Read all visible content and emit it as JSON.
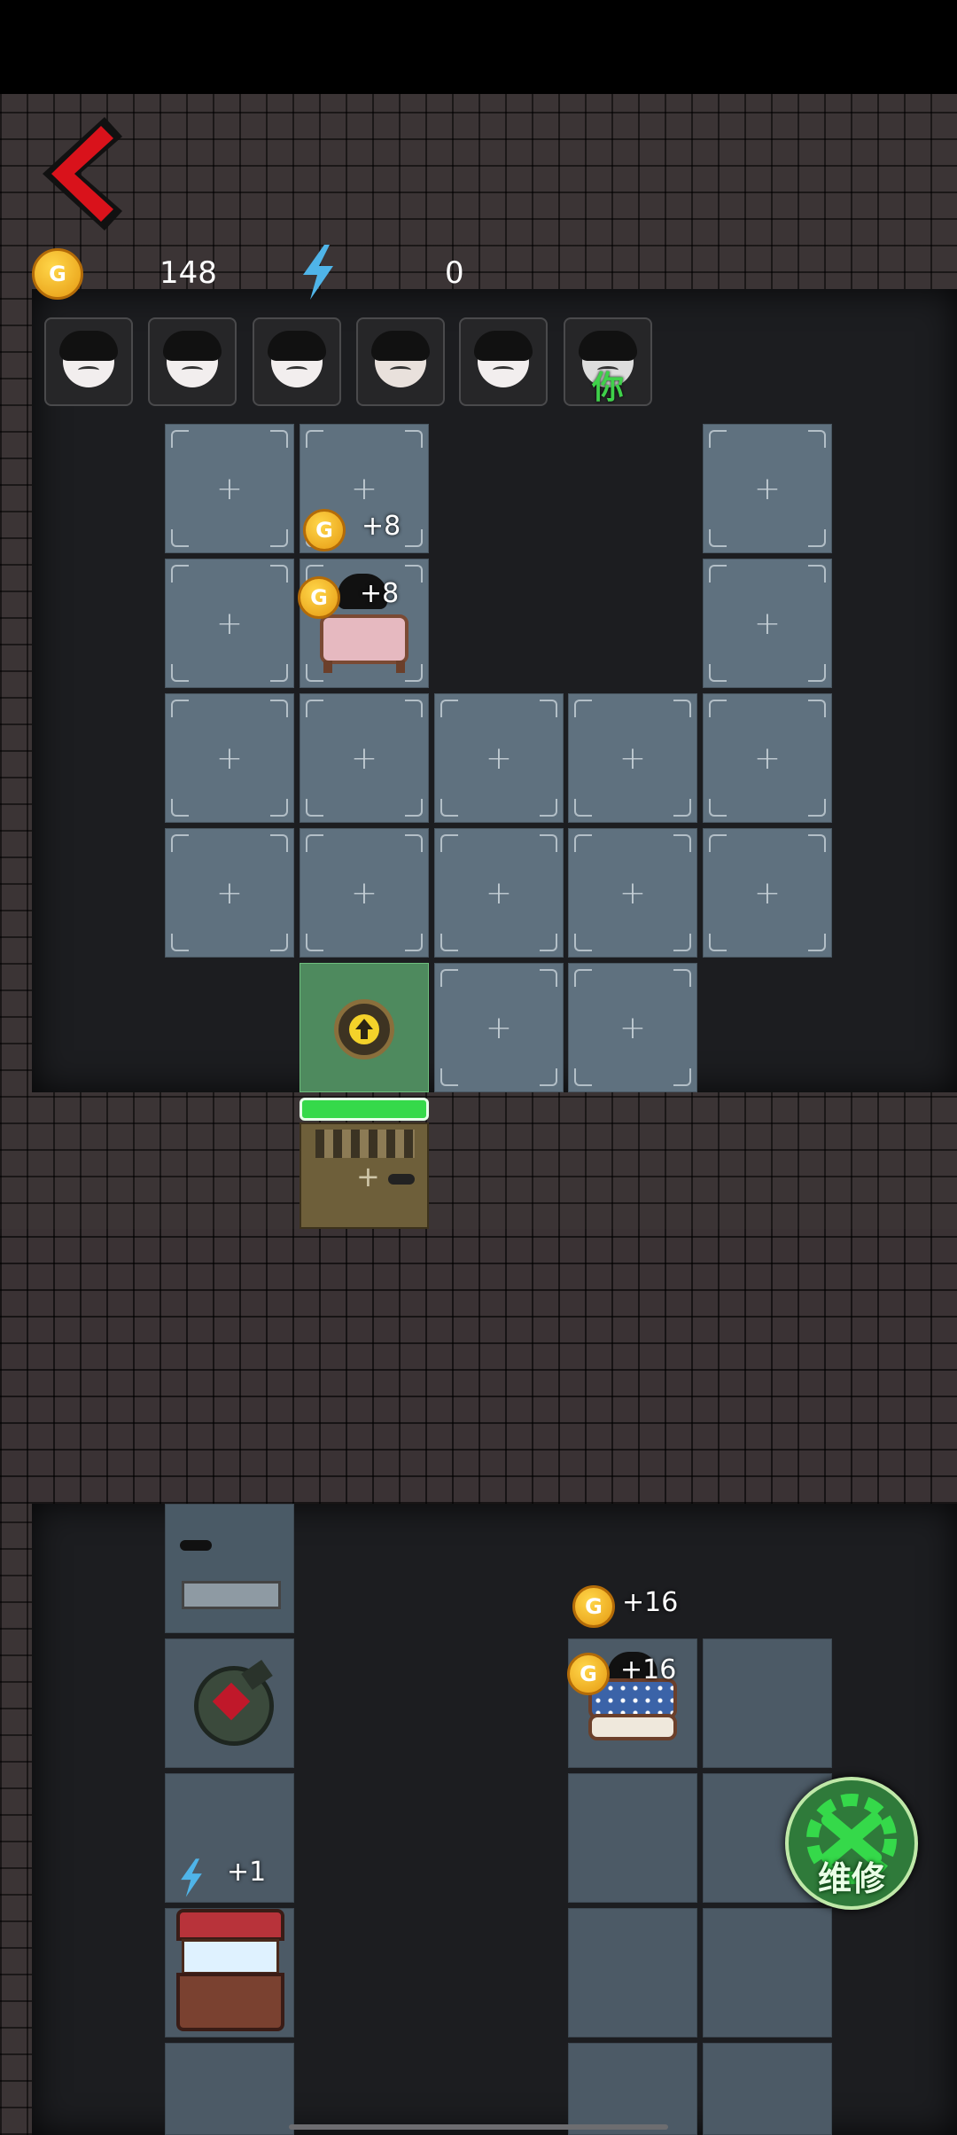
{
  "hud": {
    "gold_value": "148",
    "energy_value": "0"
  },
  "portraits": [
    {
      "name": "ghost-girl-portrait",
      "note": ""
    },
    {
      "name": "maid-girl-portrait-1",
      "note": ""
    },
    {
      "name": "maid-girl-portrait-2",
      "note": ""
    },
    {
      "name": "bun-girl-portrait",
      "note": ""
    },
    {
      "name": "boy-portrait",
      "note": ""
    },
    {
      "name": "player-portrait",
      "note": "你"
    }
  ],
  "floating_gains": {
    "upper_room_gold_1": "+8",
    "upper_room_gold_2": "+8",
    "lower_room_gold_1": "+16",
    "lower_room_gold_2": "+16",
    "energy_gain": "+1"
  },
  "repair_button": {
    "label": "维修"
  },
  "coin_letter": "G",
  "colors": {
    "tile": "#5f717f",
    "accent_green": "#35d94a",
    "gold": "#f2b31e",
    "energy": "#4fb4e8",
    "back_red": "#d9121b"
  },
  "icons": {
    "back": "chevron-left-icon",
    "gold": "gold-coin-icon",
    "energy": "lightning-icon",
    "upgrade": "arrow-up-icon",
    "repair": "wrench-gear-icon"
  }
}
